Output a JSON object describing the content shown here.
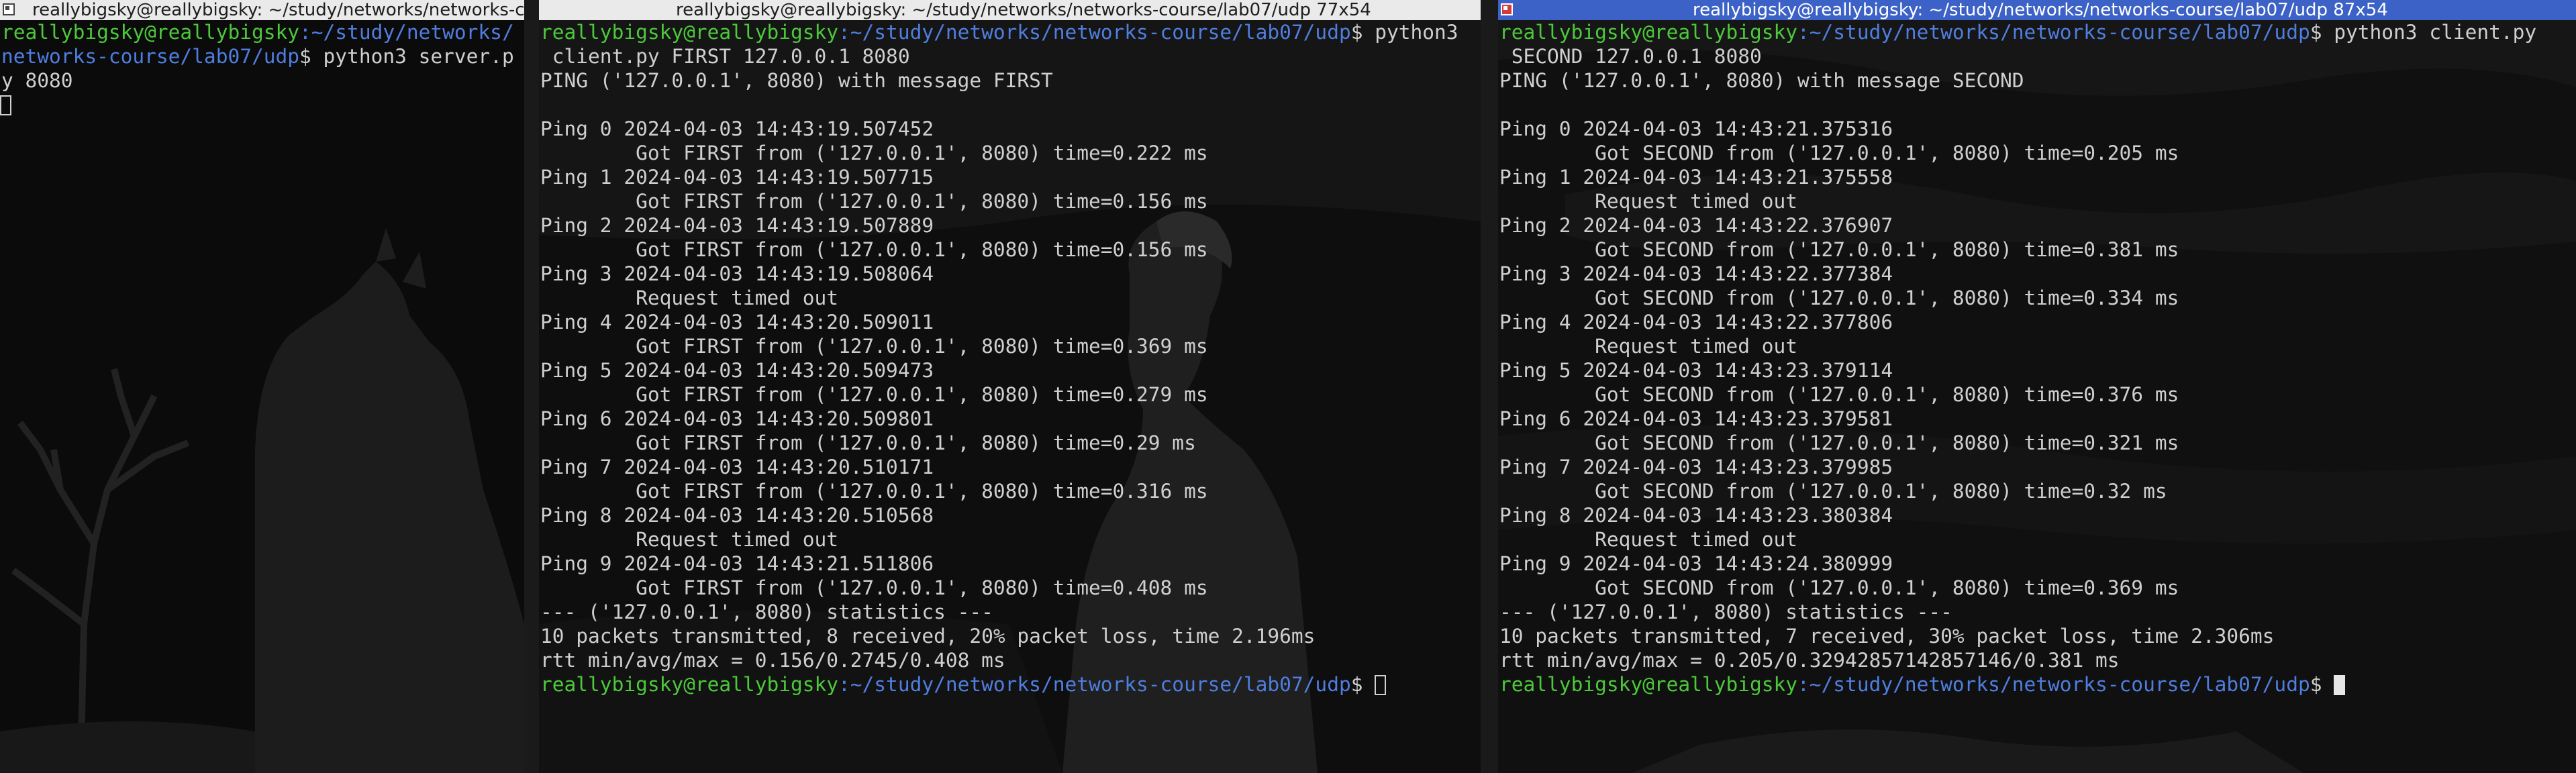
{
  "windows": [
    {
      "title": "reallybigsky@reallybigsky: ~/study/networks/networks-c",
      "lines": [
        {
          "user": "reallybigsky@reallybigsky",
          "path": ":~/study/networks/",
          "rest": ""
        },
        {
          "user": "",
          "path": "networks-course/lab07/udp",
          "rest": "$ python3 server.p"
        },
        {
          "user": "",
          "path": "",
          "rest": "y 8080"
        }
      ],
      "cursor": {
        "line": 3,
        "type": "hollow"
      }
    },
    {
      "title": "reallybigsky@reallybigsky: ~/study/networks/networks-course/lab07/udp 77x54",
      "lines": [
        {
          "user": "reallybigsky@reallybigsky",
          "path": ":~/study/networks/networks-course/lab07/udp",
          "rest": "$ python3"
        },
        {
          "user": "",
          "path": "",
          "rest": " client.py FIRST 127.0.0.1 8080"
        },
        {
          "user": "",
          "path": "",
          "rest": "PING ('127.0.0.1', 8080) with message FIRST"
        },
        {
          "user": "",
          "path": "",
          "rest": ""
        },
        {
          "user": "",
          "path": "",
          "rest": "Ping 0 2024-04-03 14:43:19.507452"
        },
        {
          "user": "",
          "path": "",
          "rest": "        Got FIRST from ('127.0.0.1', 8080) time=0.222 ms"
        },
        {
          "user": "",
          "path": "",
          "rest": "Ping 1 2024-04-03 14:43:19.507715"
        },
        {
          "user": "",
          "path": "",
          "rest": "        Got FIRST from ('127.0.0.1', 8080) time=0.156 ms"
        },
        {
          "user": "",
          "path": "",
          "rest": "Ping 2 2024-04-03 14:43:19.507889"
        },
        {
          "user": "",
          "path": "",
          "rest": "        Got FIRST from ('127.0.0.1', 8080) time=0.156 ms"
        },
        {
          "user": "",
          "path": "",
          "rest": "Ping 3 2024-04-03 14:43:19.508064"
        },
        {
          "user": "",
          "path": "",
          "rest": "        Request timed out"
        },
        {
          "user": "",
          "path": "",
          "rest": "Ping 4 2024-04-03 14:43:20.509011"
        },
        {
          "user": "",
          "path": "",
          "rest": "        Got FIRST from ('127.0.0.1', 8080) time=0.369 ms"
        },
        {
          "user": "",
          "path": "",
          "rest": "Ping 5 2024-04-03 14:43:20.509473"
        },
        {
          "user": "",
          "path": "",
          "rest": "        Got FIRST from ('127.0.0.1', 8080) time=0.279 ms"
        },
        {
          "user": "",
          "path": "",
          "rest": "Ping 6 2024-04-03 14:43:20.509801"
        },
        {
          "user": "",
          "path": "",
          "rest": "        Got FIRST from ('127.0.0.1', 8080) time=0.29 ms"
        },
        {
          "user": "",
          "path": "",
          "rest": "Ping 7 2024-04-03 14:43:20.510171"
        },
        {
          "user": "",
          "path": "",
          "rest": "        Got FIRST from ('127.0.0.1', 8080) time=0.316 ms"
        },
        {
          "user": "",
          "path": "",
          "rest": "Ping 8 2024-04-03 14:43:20.510568"
        },
        {
          "user": "",
          "path": "",
          "rest": "        Request timed out"
        },
        {
          "user": "",
          "path": "",
          "rest": "Ping 9 2024-04-03 14:43:21.511806"
        },
        {
          "user": "",
          "path": "",
          "rest": "        Got FIRST from ('127.0.0.1', 8080) time=0.408 ms"
        },
        {
          "user": "",
          "path": "",
          "rest": "--- ('127.0.0.1', 8080) statistics ---"
        },
        {
          "user": "",
          "path": "",
          "rest": "10 packets transmitted, 8 received, 20% packet loss, time 2.196ms"
        },
        {
          "user": "",
          "path": "",
          "rest": "rtt min/avg/max = 0.156/0.2745/0.408 ms"
        },
        {
          "user": "reallybigsky@reallybigsky",
          "path": ":~/study/networks/networks-course/lab07/udp",
          "rest": "$ "
        }
      ],
      "cursor": {
        "line": 27,
        "type": "hollow"
      }
    },
    {
      "title": "reallybigsky@reallybigsky: ~/study/networks/networks-course/lab07/udp 87x54",
      "lines": [
        {
          "user": "reallybigsky@reallybigsky",
          "path": ":~/study/networks/networks-course/lab07/udp",
          "rest": "$ python3 client.py"
        },
        {
          "user": "",
          "path": "",
          "rest": " SECOND 127.0.0.1 8080"
        },
        {
          "user": "",
          "path": "",
          "rest": "PING ('127.0.0.1', 8080) with message SECOND"
        },
        {
          "user": "",
          "path": "",
          "rest": ""
        },
        {
          "user": "",
          "path": "",
          "rest": "Ping 0 2024-04-03 14:43:21.375316"
        },
        {
          "user": "",
          "path": "",
          "rest": "        Got SECOND from ('127.0.0.1', 8080) time=0.205 ms"
        },
        {
          "user": "",
          "path": "",
          "rest": "Ping 1 2024-04-03 14:43:21.375558"
        },
        {
          "user": "",
          "path": "",
          "rest": "        Request timed out"
        },
        {
          "user": "",
          "path": "",
          "rest": "Ping 2 2024-04-03 14:43:22.376907"
        },
        {
          "user": "",
          "path": "",
          "rest": "        Got SECOND from ('127.0.0.1', 8080) time=0.381 ms"
        },
        {
          "user": "",
          "path": "",
          "rest": "Ping 3 2024-04-03 14:43:22.377384"
        },
        {
          "user": "",
          "path": "",
          "rest": "        Got SECOND from ('127.0.0.1', 8080) time=0.334 ms"
        },
        {
          "user": "",
          "path": "",
          "rest": "Ping 4 2024-04-03 14:43:22.377806"
        },
        {
          "user": "",
          "path": "",
          "rest": "        Request timed out"
        },
        {
          "user": "",
          "path": "",
          "rest": "Ping 5 2024-04-03 14:43:23.379114"
        },
        {
          "user": "",
          "path": "",
          "rest": "        Got SECOND from ('127.0.0.1', 8080) time=0.376 ms"
        },
        {
          "user": "",
          "path": "",
          "rest": "Ping 6 2024-04-03 14:43:23.379581"
        },
        {
          "user": "",
          "path": "",
          "rest": "        Got SECOND from ('127.0.0.1', 8080) time=0.321 ms"
        },
        {
          "user": "",
          "path": "",
          "rest": "Ping 7 2024-04-03 14:43:23.379985"
        },
        {
          "user": "",
          "path": "",
          "rest": "        Got SECOND from ('127.0.0.1', 8080) time=0.32 ms"
        },
        {
          "user": "",
          "path": "",
          "rest": "Ping 8 2024-04-03 14:43:23.380384"
        },
        {
          "user": "",
          "path": "",
          "rest": "        Request timed out"
        },
        {
          "user": "",
          "path": "",
          "rest": "Ping 9 2024-04-03 14:43:24.380999"
        },
        {
          "user": "",
          "path": "",
          "rest": "        Got SECOND from ('127.0.0.1', 8080) time=0.369 ms"
        },
        {
          "user": "",
          "path": "",
          "rest": "--- ('127.0.0.1', 8080) statistics ---"
        },
        {
          "user": "",
          "path": "",
          "rest": "10 packets transmitted, 7 received, 30% packet loss, time 2.306ms"
        },
        {
          "user": "",
          "path": "",
          "rest": "rtt min/avg/max = 0.205/0.32942857142857146/0.381 ms"
        },
        {
          "user": "reallybigsky@reallybigsky",
          "path": ":~/study/networks/networks-course/lab07/udp",
          "rest": "$ "
        }
      ],
      "cursor": {
        "line": 27,
        "type": "block"
      }
    }
  ],
  "colors": {
    "prompt_user": "#4cc93a",
    "prompt_path": "#4f7ee0",
    "text": "#cfcfcf",
    "active_titlebar": "#3d62c7"
  }
}
